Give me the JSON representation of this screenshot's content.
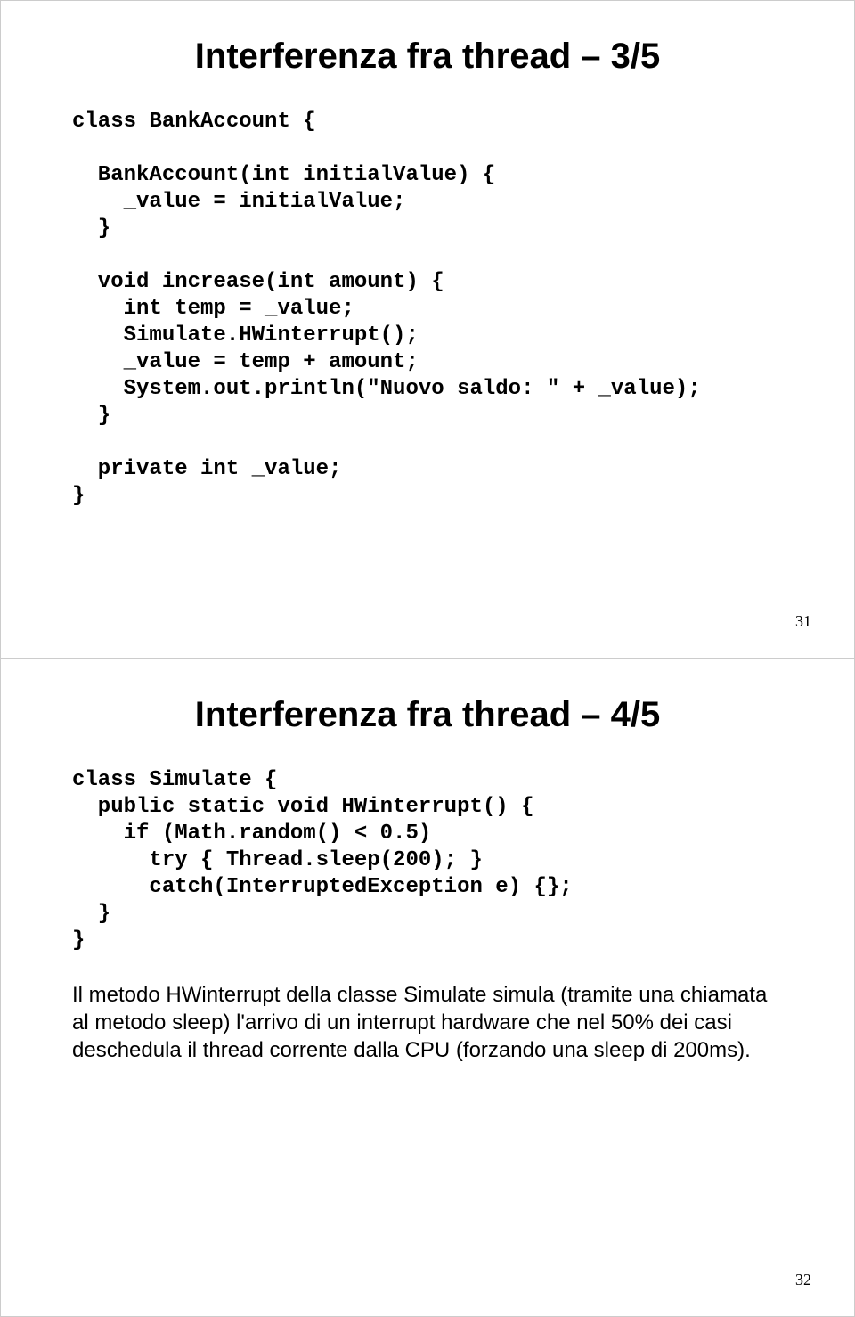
{
  "slide1": {
    "title": "Interferenza fra thread – 3/5",
    "code": "class BankAccount {\n\n  BankAccount(int initialValue) {\n    _value = initialValue;\n  }\n\n  void increase(int amount) {\n    int temp = _value;\n    Simulate.HWinterrupt();\n    _value = temp + amount;\n    System.out.println(\"Nuovo saldo: \" + _value);\n  }\n\n  private int _value;\n}",
    "page": "31"
  },
  "slide2": {
    "title": "Interferenza fra thread – 4/5",
    "code": "class Simulate {\n  public static void HWinterrupt() {\n    if (Math.random() < 0.5)\n      try { Thread.sleep(200); }\n      catch(InterruptedException e) {};\n  }\n}",
    "body": "Il metodo HWinterrupt della classe Simulate simula (tramite una chiamata al metodo sleep) l'arrivo di un interrupt hardware che nel 50% dei casi deschedula il thread corrente dalla CPU (forzando una sleep di 200ms).",
    "page": "32"
  }
}
